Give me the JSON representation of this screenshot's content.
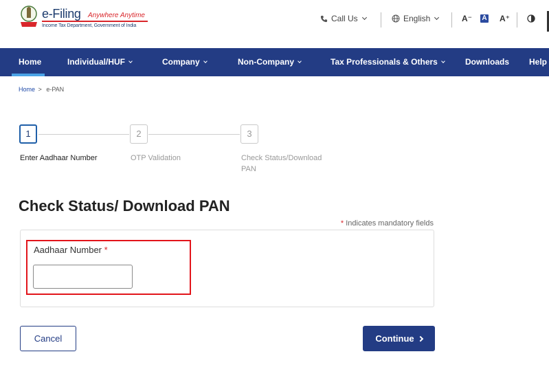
{
  "header": {
    "brand": "e-Filing",
    "tagline": "Anywhere Anytime",
    "subtitle": "Income Tax Department, Government of India",
    "call_us": "Call Us",
    "language": "English",
    "font_decrease": "A⁻",
    "font_default": "A",
    "font_increase": "A⁺",
    "contrast_icon": "contrast-icon",
    "colors": {
      "brand_navy": "#1d3c6e",
      "brand_red": "#d9262b"
    }
  },
  "nav": {
    "items": [
      {
        "label": "Home"
      },
      {
        "label": "Individual/HUF"
      },
      {
        "label": "Company"
      },
      {
        "label": "Non-Company"
      },
      {
        "label": "Tax Professionals & Others"
      },
      {
        "label": "Downloads"
      },
      {
        "label": "Help"
      }
    ],
    "background": "#233c84",
    "active_indicator": "#4aa3e6"
  },
  "breadcrumb": {
    "home": "Home",
    "separator": ">",
    "current": "e-PAN"
  },
  "stepper": {
    "steps": [
      {
        "number": "1",
        "label": "Enter Aadhaar Number",
        "state": "active"
      },
      {
        "number": "2",
        "label": "OTP Validation",
        "state": "inactive"
      },
      {
        "number": "3",
        "label_line1": "Check Status/Download",
        "label_line2": "PAN",
        "state": "inactive"
      }
    ]
  },
  "page": {
    "title": "Check Status/ Download PAN",
    "mandatory_star": "*",
    "mandatory_note": "Indicates mandatory fields"
  },
  "form": {
    "aadhaar_label": "Aadhaar Number",
    "aadhaar_required": "*",
    "aadhaar_value": "",
    "highlight_color": "#e2141a"
  },
  "buttons": {
    "cancel": "Cancel",
    "continue": "Continue"
  }
}
